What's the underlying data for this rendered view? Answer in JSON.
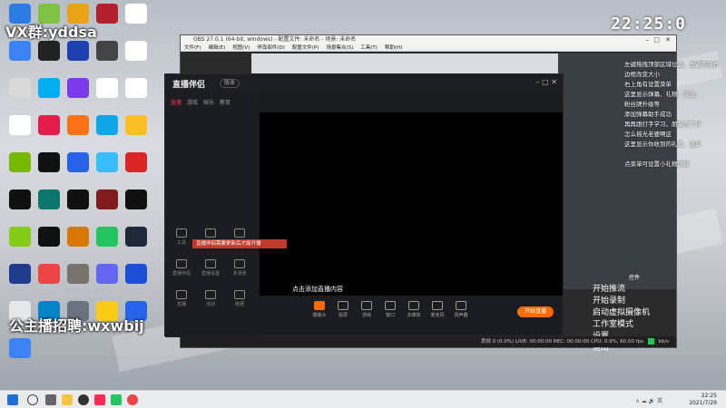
{
  "desktop": {
    "watermark_top": "VX群:yddsa",
    "watermark_bottom": "公主播招聘:wxwbij",
    "icons": [
      {
        "label": "",
        "color": "#2d7be5"
      },
      {
        "label": "",
        "color": "#7dc242"
      },
      {
        "label": "",
        "color": "#e8a317"
      },
      {
        "label": "",
        "color": "#b21f2d"
      },
      {
        "label": "",
        "color": "#ffffff"
      },
      {
        "label": "",
        "color": "#3b82f6"
      },
      {
        "label": "",
        "color": "#222222"
      },
      {
        "label": "",
        "color": "#1e40af"
      },
      {
        "label": "",
        "color": "#444444"
      },
      {
        "label": "",
        "color": "#ffffff"
      },
      {
        "label": "",
        "color": "#d9d9d9"
      },
      {
        "label": "",
        "color": "#00aeef"
      },
      {
        "label": "",
        "color": "#7c3aed"
      },
      {
        "label": "",
        "color": "#ffffff"
      },
      {
        "label": "",
        "color": "#ffffff"
      },
      {
        "label": "",
        "color": "#ffffff"
      },
      {
        "label": "",
        "color": "#e11d48"
      },
      {
        "label": "",
        "color": "#f97316"
      },
      {
        "label": "",
        "color": "#0ea5e9"
      },
      {
        "label": "",
        "color": "#fbbf24"
      },
      {
        "label": "",
        "color": "#76b900"
      },
      {
        "label": "",
        "color": "#111111"
      },
      {
        "label": "",
        "color": "#2563eb"
      },
      {
        "label": "",
        "color": "#38bdf8"
      },
      {
        "label": "",
        "color": "#dc2626"
      },
      {
        "label": "",
        "color": "#111111"
      },
      {
        "label": "",
        "color": "#0f766e"
      },
      {
        "label": "",
        "color": "#111111"
      },
      {
        "label": "",
        "color": "#7f1d1d"
      },
      {
        "label": "",
        "color": "#111111"
      },
      {
        "label": "",
        "color": "#84cc16"
      },
      {
        "label": "",
        "color": "#111111"
      },
      {
        "label": "",
        "color": "#d97706"
      },
      {
        "label": "",
        "color": "#22c55e"
      },
      {
        "label": "",
        "color": "#1f2937"
      },
      {
        "label": "",
        "color": "#1e3a8a"
      },
      {
        "label": "",
        "color": "#ef4444"
      },
      {
        "label": "",
        "color": "#78716c"
      },
      {
        "label": "",
        "color": "#6366f1"
      },
      {
        "label": "",
        "color": "#1d4ed8"
      },
      {
        "label": "",
        "color": "#e5e7eb"
      },
      {
        "label": "",
        "color": "#0284c7"
      },
      {
        "label": "",
        "color": "#6b7280"
      },
      {
        "label": "",
        "color": "#facc15"
      },
      {
        "label": "",
        "color": "#2563eb"
      },
      {
        "label": "",
        "color": "#3b82f6"
      }
    ]
  },
  "obs": {
    "title": "OBS 27.0.1 (64-bit, windows) - 配置文件: 未命名 - 场景: 未命名",
    "menu": [
      "文件(F)",
      "编辑(E)",
      "视图(V)",
      "停靠部件(D)",
      "配置文件(P)",
      "场景集合(S)",
      "工具(T)",
      "帮助(H)"
    ],
    "right_panel_rows": [
      "控件",
      "开始推流",
      "开始录制",
      "启动虚拟摄像机",
      "工作室模式",
      "设置",
      "退出"
    ],
    "status": "丢帧 0 (0.0%)   LIVE: 00:00:00   REC: 00:00:00   CPU: 0.9%, 60.00 fps",
    "status_right": "kb/s"
  },
  "live": {
    "logo": "直播伴侣",
    "version": "版本",
    "tabs": [
      "直播",
      "游戏",
      "娱乐",
      "教育"
    ],
    "tools": [
      {
        "label": "工具"
      },
      {
        "label": "美颜"
      },
      {
        "label": "开播记录"
      },
      {
        "label": "直播伴侣"
      },
      {
        "label": "直播设置"
      },
      {
        "label": "多场景"
      },
      {
        "label": "直播"
      },
      {
        "label": "活动"
      },
      {
        "label": "数据"
      }
    ],
    "hint": "点击添加直播内容",
    "toast": "直播伴侣需要更新后才能开播",
    "bottom_buttons": [
      {
        "label": "摄像头"
      },
      {
        "label": "投屏"
      },
      {
        "label": "游戏"
      },
      {
        "label": "窗口"
      },
      {
        "label": "多媒体"
      },
      {
        "label": "麦克风"
      },
      {
        "label": "扬声器"
      }
    ],
    "go_live": "开始直播"
  },
  "chat": {
    "lines": [
      "左键拖拽顶部区域位置，左键拖拽右",
      "边框改变大小",
      "右上角有设置菜单",
      "这里显示弹幕、礼物、关注、",
      "粉丝牌升级等",
      "添加弹幕助手成功",
      "再再跟打字学习，朋友看了行",
      "怎么摇光老婆啊这",
      "这里显示你收到的礼物、道具",
      "",
      "点菜单可设置小礼物屏蔽"
    ]
  },
  "clock": {
    "big": "22:25:0",
    "time": "22:25",
    "date": "2021/7/29"
  },
  "colors": {
    "accent": "#fe2c55",
    "live_button": "#fe6b00",
    "obs_green": "#22c55e"
  }
}
